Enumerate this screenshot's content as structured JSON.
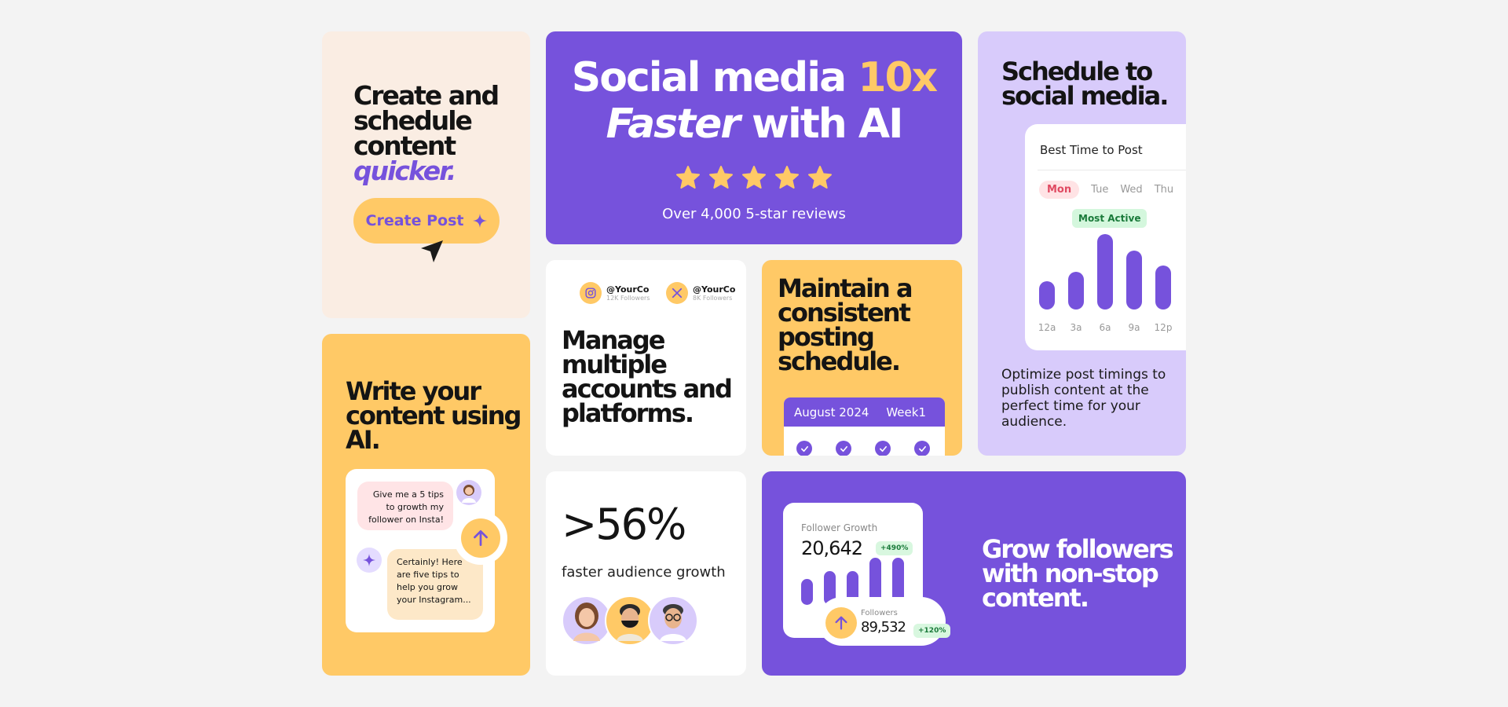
{
  "create_card": {
    "heading_lines": [
      "Create and",
      "schedule",
      "content"
    ],
    "heading_accent": "quicker.",
    "button_label": "Create Post"
  },
  "hero": {
    "title_part1": "Social media ",
    "title_accent": "10x",
    "title_italic": "Faster",
    "title_part2": " with AI",
    "stars": 5,
    "reviews": "Over 4,000 5-star reviews"
  },
  "schedule_card": {
    "heading_lines": [
      "Schedule to",
      "social media."
    ],
    "panel_title": "Best Time to Post",
    "days": [
      "Mon",
      "Tue",
      "Wed",
      "Thu"
    ],
    "most_active": "Most Active",
    "description": "Optimize post timings to publish content at the perfect time for your audience."
  },
  "chart_data": {
    "type": "bar",
    "title": "Best Time to Post",
    "categories": [
      "12a",
      "3a",
      "6a",
      "9a",
      "12p"
    ],
    "values": [
      38,
      50,
      100,
      78,
      58
    ],
    "ylim": [
      0,
      100
    ]
  },
  "ai_card": {
    "heading_lines": [
      "Write your",
      "content using",
      "AI."
    ],
    "user_message": "Give me a 5 tips to growth my follower on Insta!",
    "ai_message": "Certainly! Here are five tips to help you grow your Instagram..."
  },
  "accounts_card": {
    "accounts": [
      {
        "handle": "@YourCo",
        "followers": "12K Followers",
        "platform": "instagram-icon"
      },
      {
        "handle": "@YourCo",
        "followers": "8K Followers",
        "platform": "x-icon"
      }
    ],
    "heading_lines": [
      "Manage",
      "multiple",
      "accounts and",
      "platforms."
    ]
  },
  "consistent_card": {
    "heading_lines": [
      "Maintain a",
      "consistent",
      "posting",
      "schedule."
    ],
    "calendar_month": "August 2024",
    "calendar_week": "Week1"
  },
  "growth_stat_card": {
    "stat": ">56%",
    "label": "faster audience growth"
  },
  "followers_card": {
    "panel_label": "Follower Growth",
    "panel_value": "20,642",
    "panel_pill": "+490%",
    "follower_bars": [
      0.55,
      0.72,
      0.72,
      1.0,
      1.0
    ],
    "followers_label": "Followers",
    "followers_value": "89,532",
    "followers_pill": "+120%",
    "heading_lines": [
      "Grow followers",
      "with non-stop",
      "content."
    ]
  },
  "colors": {
    "purple": "#7652dc",
    "yellow": "#ffc966",
    "cream": "#faede3",
    "lavender": "#d8cbfb"
  }
}
